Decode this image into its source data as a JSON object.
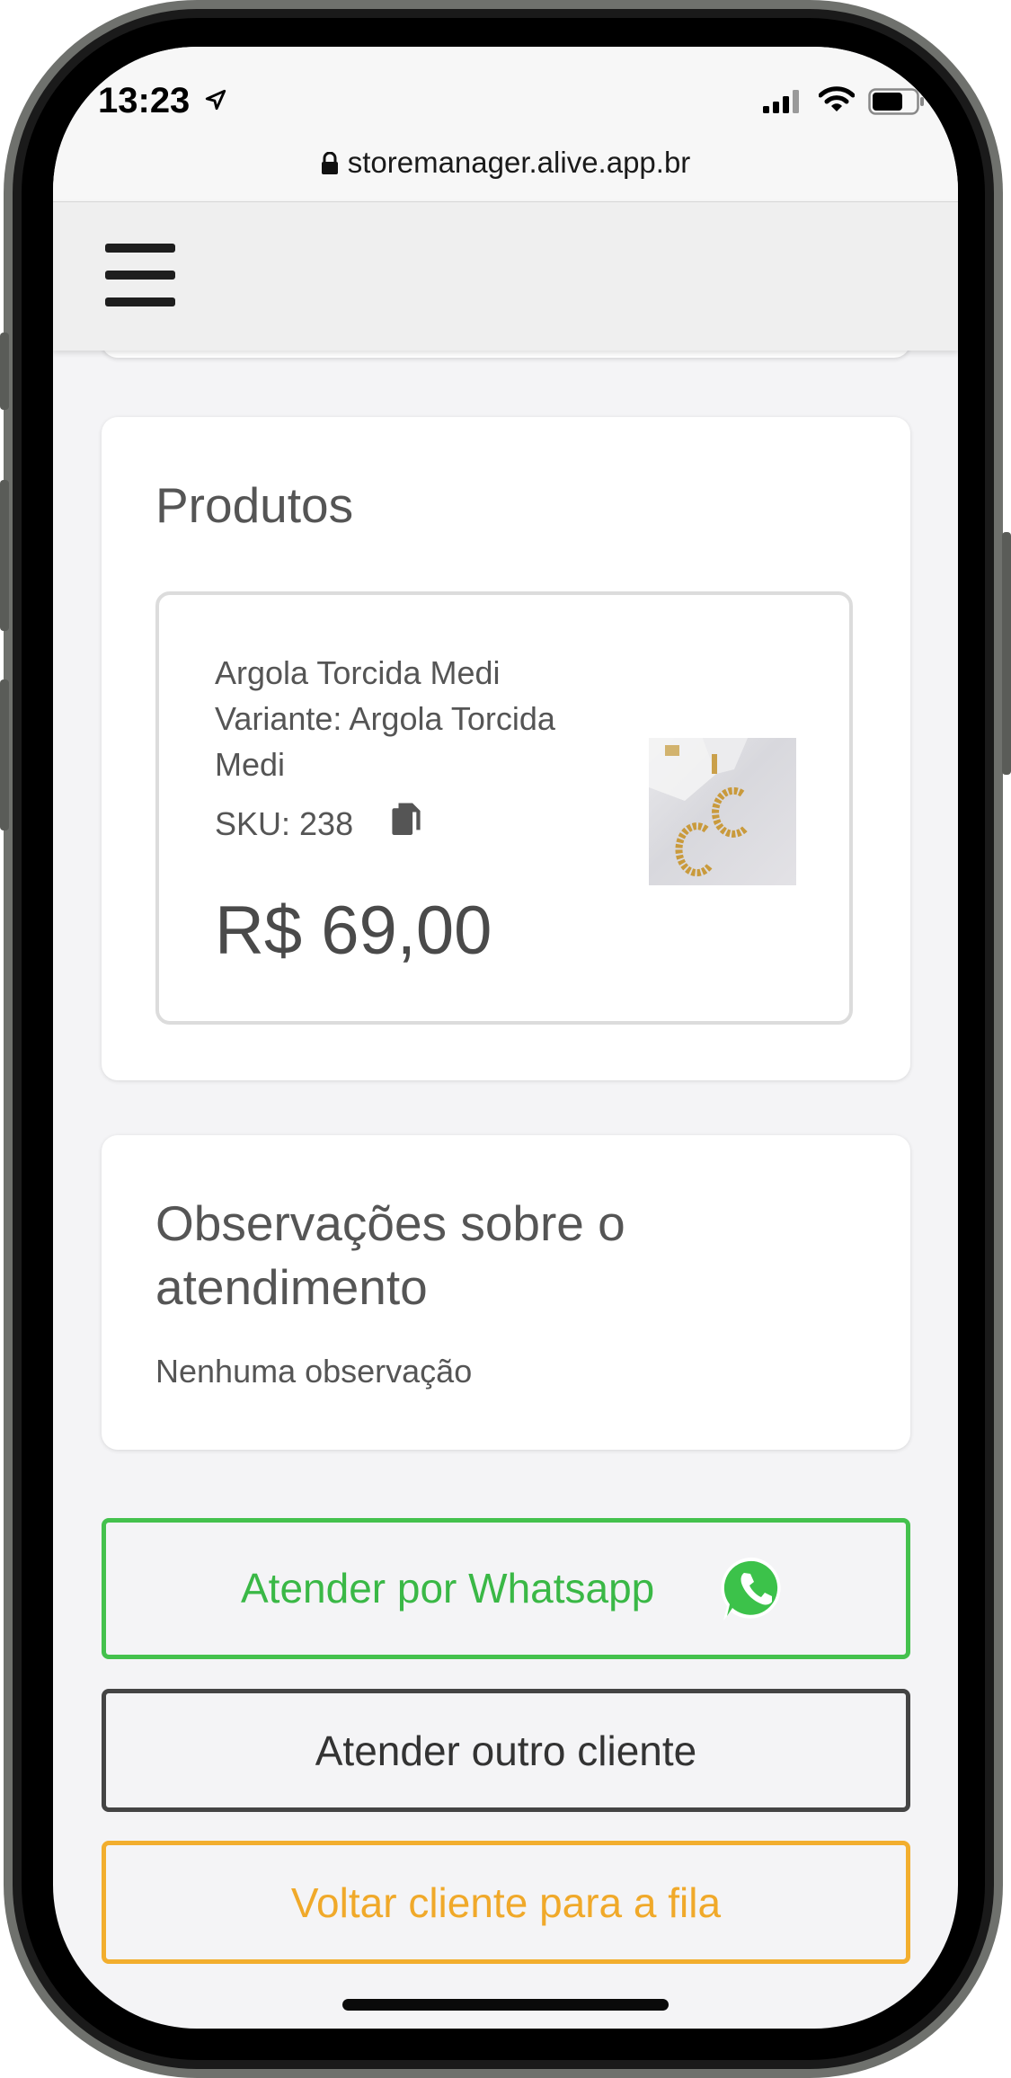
{
  "status_bar": {
    "time": "13:23",
    "icons": [
      "location-arrow-icon",
      "cellular-signal-icon",
      "wifi-icon",
      "battery-icon"
    ]
  },
  "browser": {
    "url": "storemanager.alive.app.br",
    "lock_icon": "lock-icon"
  },
  "header": {
    "menu_icon": "hamburger-menu-icon"
  },
  "products_card": {
    "title": "Produtos",
    "item": {
      "name": "Argola Torcida Medi",
      "variant_line1": "Variante: Argola Torcida",
      "variant_line2": "Medi",
      "sku": "SKU: 238",
      "price": "R$ 69,00",
      "copy_icon": "copy-icon"
    }
  },
  "notes_card": {
    "title_line1": "Observações sobre o",
    "title_line2": "atendimento",
    "text": "Nenhuma observação"
  },
  "actions": {
    "whatsapp_label": "Atender por Whatsapp",
    "other_client_label": "Atender outro cliente",
    "back_to_queue_label": "Voltar cliente para a fila"
  },
  "colors": {
    "whatsapp_green": "#44c14d",
    "queue_orange": "#f2ae2e",
    "dark_border": "#444444",
    "page_bg": "#f4f4f6"
  }
}
